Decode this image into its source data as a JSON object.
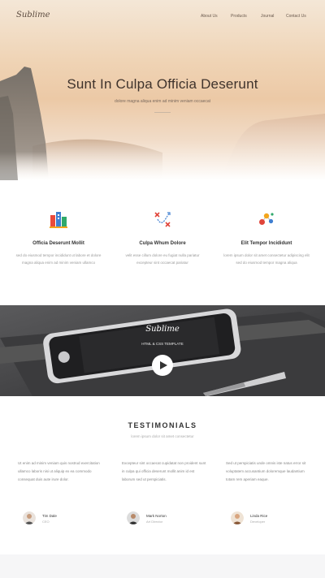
{
  "brand": {
    "logo": "Sublime"
  },
  "nav": {
    "items": [
      "About Us",
      "Products",
      "Journal",
      "Contact Us"
    ]
  },
  "hero": {
    "title": "Sunt In Culpa Officia Deserunt",
    "subtitle": "dolore magna aliqua enim ad minim veniam occaecat"
  },
  "features": [
    {
      "icon": "buildings-icon",
      "title": "Officia Deserunt Mollit",
      "desc": "sed do eiusmod tempor incididunt ut labore et dolore magna aliqua enim ad minim veniam ullamco"
    },
    {
      "icon": "strategy-icon",
      "title": "Culpa Whum Dolore",
      "desc": "velit esse cillum dolore eu fugiat nulla pariatur excepteur sint occaecat pariatur"
    },
    {
      "icon": "molecule-icon",
      "title": "Elit Tempor Incididunt",
      "desc": "lorem ipsum dolor sit amet consectetur adipiscing elit sed do eiusmod tempor magna aliqua"
    }
  ],
  "showcase": {
    "title": "Sublime",
    "subtitle": "HTML & CSS TEMPLATE"
  },
  "testimonials": {
    "heading": "TESTIMONIALS",
    "subheading": "lorem ipsum dolor sit amet consectetur",
    "items": [
      {
        "quote": "Ut enim ad minim veniam quis nostrud exercitation ullamco laboris nisi ut aliquip ex ea commodo consequat duis aute irure dolor.",
        "name": "Tim Dale",
        "role": "CEO"
      },
      {
        "quote": "Excepteur sint occaecat cupidatat non proident sunt in culpa qui officia deserunt mollit anim id est laborum sed ut perspiciatis.",
        "name": "Mark Norton",
        "role": "Art Director"
      },
      {
        "quote": "Sed ut perspiciatis unde omnis iste natus error sit voluptatem accusantium doloremque laudantium totam rem aperiam eaque.",
        "name": "Linda Rice",
        "role": "Developer"
      }
    ]
  }
}
